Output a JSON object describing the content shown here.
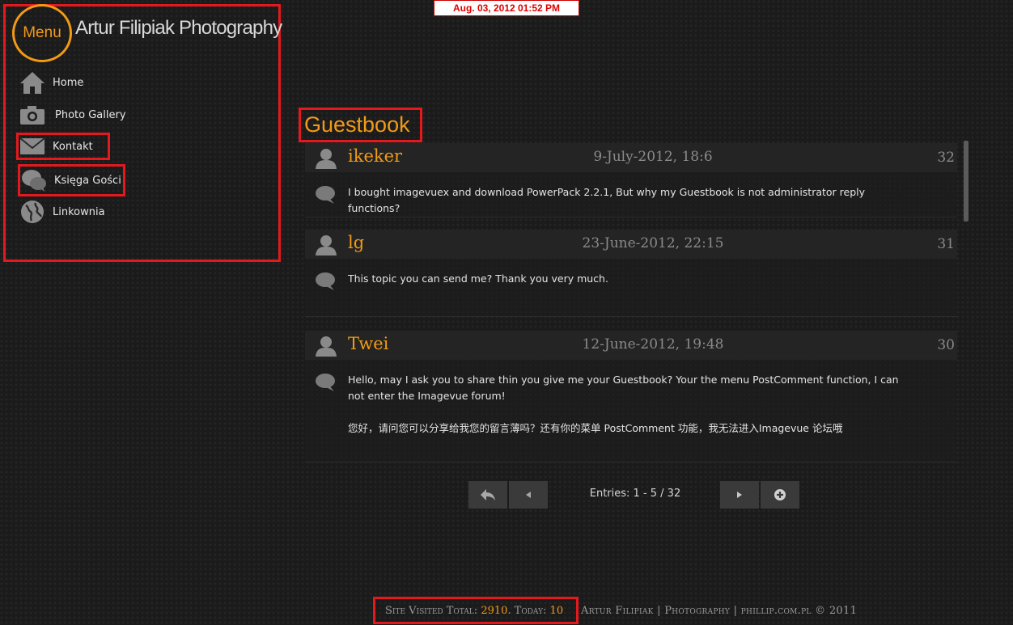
{
  "datetime": "Aug. 03, 2012  01:52 PM",
  "menu": {
    "label": "Menu",
    "site_title": "Artur Filipiak Photography",
    "items": [
      {
        "label": "Home",
        "icon": "home-icon"
      },
      {
        "label": "Photo Gallery",
        "icon": "camera-icon"
      },
      {
        "label": "Kontakt",
        "icon": "envelope-icon"
      },
      {
        "label": "Księga Gości",
        "icon": "chat-bubbles-icon"
      },
      {
        "label": "Linkownia",
        "icon": "globe-icon"
      }
    ]
  },
  "guestbook": {
    "title": "Guestbook",
    "entries": [
      {
        "name": "ikeker",
        "date": "9-July-2012, 18:6",
        "number": "32",
        "text": "I bought imagevuex and download PowerPack 2.2.1, But why my Guestbook is not administrator reply functions?"
      },
      {
        "name": "lg",
        "date": "23-June-2012, 22:15",
        "number": "31",
        "text": "This topic you can send me? Thank you very much."
      },
      {
        "name": "Twei",
        "date": "12-June-2012, 19:48",
        "number": "30",
        "text": "Hello, may I ask you to share thin you give me your Guestbook? Your the menu PostComment function, I can not enter the Imagevue forum!\n\n您好，请问您可以分享给我您的留言薄吗？还有你的菜单 PostComment 功能，我无法进入Imagevue 论坛哦"
      }
    ],
    "pagination": {
      "entries_label": "Entries: 1 - 5 / 32"
    }
  },
  "footer": {
    "visited_label": "Site Visited Total:",
    "visited_total": "2910",
    "today_label": ". Today:",
    "today_count": "10",
    "credit": "Artur Filipiak | Photography | phillip.com.pl © 2011"
  },
  "colors": {
    "accent": "#f29a16",
    "highlight": "#e3191e",
    "background": "#1b1b1b"
  }
}
